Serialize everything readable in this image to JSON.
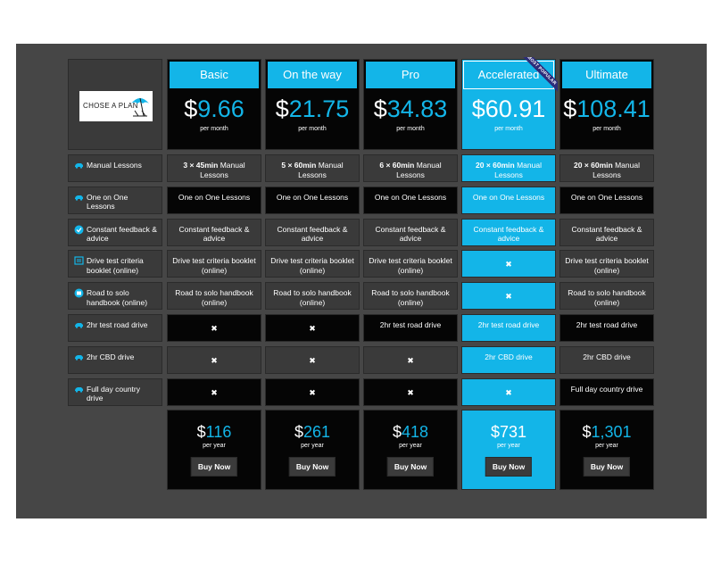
{
  "logo": {
    "text": "CHOSE A PLAN"
  },
  "colors": {
    "accent": "#13b5e8",
    "dark": "#050505",
    "grey": "#3a3a3a",
    "stage": "#464646",
    "ribbon": "#2d2d7a"
  },
  "plans": [
    {
      "name": "Basic",
      "price_dollar": "$",
      "price_value": "9.66",
      "per_month": "per month",
      "yearly_dollar": "$",
      "yearly_value": "116",
      "per_year": "per year",
      "buy": "Buy Now"
    },
    {
      "name": "On the way",
      "price_dollar": "$",
      "price_value": "21.75",
      "per_month": "per month",
      "yearly_dollar": "$",
      "yearly_value": "261",
      "per_year": "per year",
      "buy": "Buy Now"
    },
    {
      "name": "Pro",
      "price_dollar": "$",
      "price_value": "34.83",
      "per_month": "per month",
      "yearly_dollar": "$",
      "yearly_value": "418",
      "per_year": "per year",
      "buy": "Buy Now"
    },
    {
      "name": "Accelerated",
      "price_dollar": "$",
      "price_value": "60.91",
      "per_month": "per month",
      "yearly_dollar": "$",
      "yearly_value": "731",
      "per_year": "per year",
      "buy": "Buy Now",
      "badge": "MOST POPULAR"
    },
    {
      "name": "Ultimate",
      "price_dollar": "$",
      "price_value": "108.41",
      "per_month": "per month",
      "yearly_dollar": "$",
      "yearly_value": "1,301",
      "per_year": "per year",
      "buy": "Buy Now"
    }
  ],
  "features": [
    {
      "label": "Manual Lessons",
      "icon": "car-icon",
      "values": [
        {
          "bold": "3 × 45min",
          "rest": " Manual Lessons"
        },
        {
          "bold": "5 × 60min",
          "rest": " Manual Lessons"
        },
        {
          "bold": "6 × 60min",
          "rest": " Manual Lessons"
        },
        {
          "bold": "20 × 60min",
          "rest": " Manual Lessons"
        },
        {
          "bold": "20 × 60min",
          "rest": " Manual Lessons"
        }
      ]
    },
    {
      "label": "One on One Lessons",
      "icon": "car-icon",
      "values": [
        {
          "text": "One on One Lessons"
        },
        {
          "text": "One on One Lessons"
        },
        {
          "text": "One on One Lessons"
        },
        {
          "text": "One on One Lessons"
        },
        {
          "text": "One on One Lessons"
        }
      ]
    },
    {
      "label": "Constant feedback & advice",
      "icon": "check-circle-icon",
      "values": [
        {
          "text": "Constant feedback & advice"
        },
        {
          "text": "Constant feedback & advice"
        },
        {
          "text": "Constant feedback & advice"
        },
        {
          "text": "Constant feedback & advice"
        },
        {
          "text": "Constant feedback & advice"
        }
      ]
    },
    {
      "label": "Drive test criteria booklet (online)",
      "icon": "booklet-icon",
      "values": [
        {
          "text": "Drive test criteria booklet (online)"
        },
        {
          "text": "Drive test criteria booklet (online)"
        },
        {
          "text": "Drive test criteria booklet (online)"
        },
        {
          "x": "✖"
        },
        {
          "text": "Drive test criteria booklet (online)"
        }
      ]
    },
    {
      "label": "Road to solo handbook (online)",
      "icon": "handbook-icon",
      "values": [
        {
          "text": "Road to solo handbook (online)"
        },
        {
          "text": "Road to solo handbook (online)"
        },
        {
          "text": "Road to solo handbook (online)"
        },
        {
          "x": "✖"
        },
        {
          "text": "Road to solo handbook (online)"
        }
      ]
    },
    {
      "label": "2hr test road drive",
      "icon": "car-icon",
      "values": [
        {
          "x": "✖"
        },
        {
          "x": "✖"
        },
        {
          "text": "2hr test road drive"
        },
        {
          "text": "2hr test road drive"
        },
        {
          "text": "2hr test road drive"
        }
      ]
    },
    {
      "label": "2hr CBD drive",
      "icon": "car-icon",
      "values": [
        {
          "x": "✖"
        },
        {
          "x": "✖"
        },
        {
          "x": "✖"
        },
        {
          "text": "2hr CBD drive"
        },
        {
          "text": "2hr CBD drive"
        }
      ]
    },
    {
      "label": "Full day country drive",
      "icon": "car-icon",
      "values": [
        {
          "x": "✖"
        },
        {
          "x": "✖"
        },
        {
          "x": "✖"
        },
        {
          "x": "✖"
        },
        {
          "text": "Full day country drive"
        }
      ]
    }
  ]
}
